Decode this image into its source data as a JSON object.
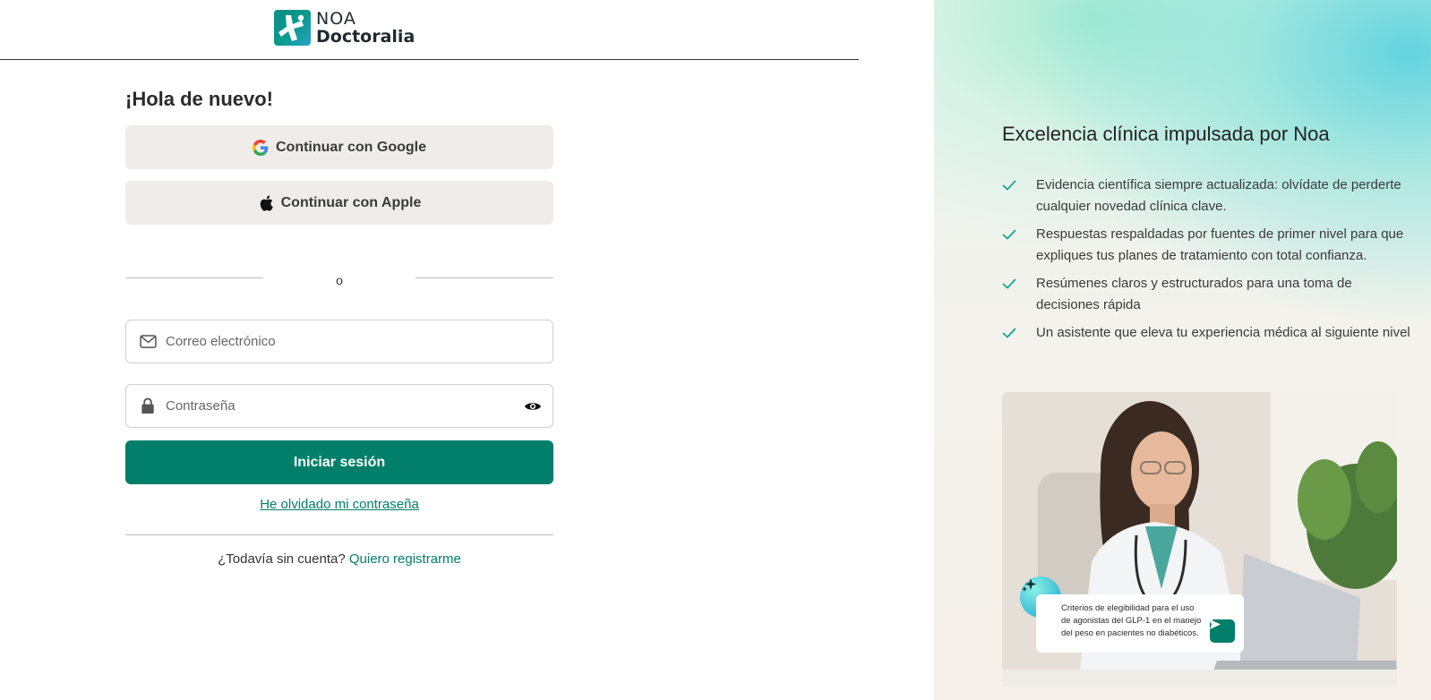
{
  "brand": {
    "logo_line1": "NOA",
    "logo_line2": "Doctoralia"
  },
  "login": {
    "title": "¡Hola de nuevo!",
    "google_label": "Continuar con Google",
    "apple_label": "Continuar con Apple",
    "divider_text": "o",
    "email_placeholder": "Correo electrónico",
    "email_value": "",
    "password_placeholder": "Contraseña",
    "password_value": "",
    "submit_label": "Iniciar sesión",
    "forgot_label": "He olvidado mi contraseña",
    "signup_prompt": "¿Todavía sin cuenta?",
    "signup_link": "Quiero registrarme"
  },
  "promo": {
    "title": "Excelencia clínica impulsada por Noa",
    "benefits": [
      "Evidencia científica siempre actualizada: olvídate de perderte cualquier novedad clínica clave.",
      "Respuestas respaldadas por fuentes de primer nivel para que expliques tus planes de tratamiento con total confianza.",
      "Resúmenes claros y estructurados para una toma de decisiones rápida",
      "Un asistente que eleva tu experiencia médica al siguiente nivel"
    ],
    "prompt_text": "Criterios de elegibilidad para el uso de agonistas del GLP-1 en el manejo del peso en pacientes no diabéticos."
  },
  "colors": {
    "primary": "#017f6a",
    "sso_bg": "#f0ece9",
    "check": "#1aa58a"
  },
  "icons": {
    "google": "google-icon",
    "apple": "apple-icon",
    "email": "mail-icon",
    "password": "lock-icon",
    "toggle_password": "eye-icon",
    "benefit": "check-icon",
    "assistant": "sparkle-icon",
    "send": "send-icon"
  }
}
